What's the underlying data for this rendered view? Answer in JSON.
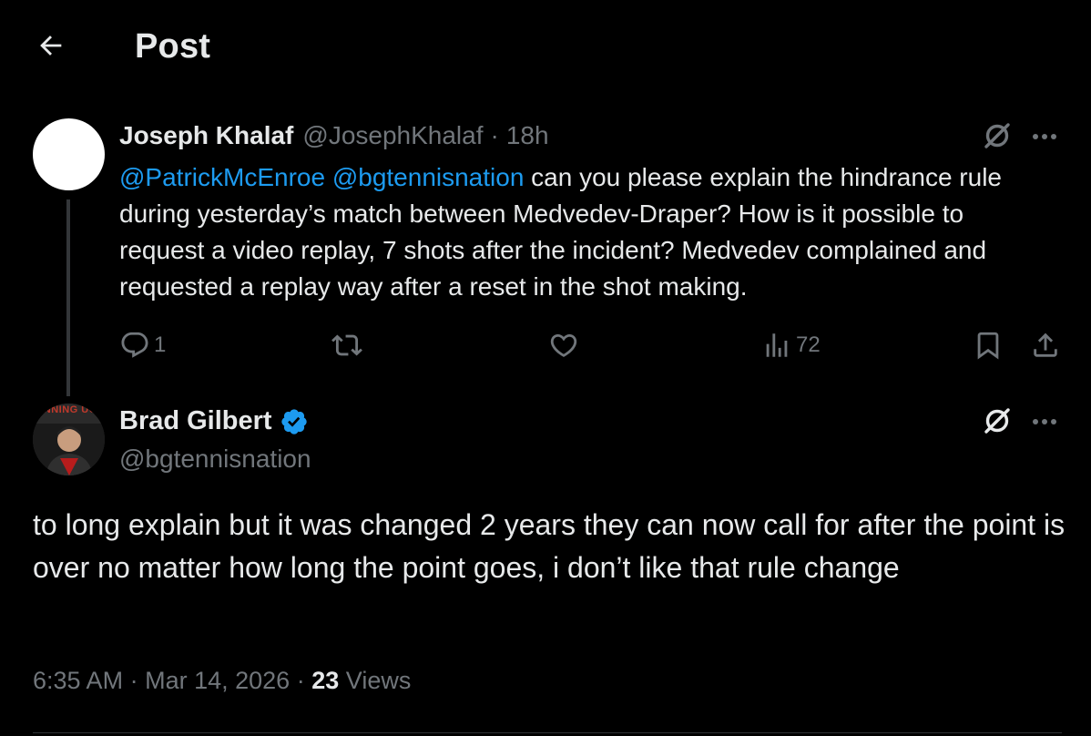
{
  "header": {
    "title": "Post"
  },
  "parent_tweet": {
    "display_name": "Joseph Khalaf",
    "handle": "@JosephKhalaf",
    "separator": "·",
    "time_ago": "18h",
    "mention_1": "@PatrickMcEnroe",
    "mention_2": "@bgtennisnation",
    "text": " can you please explain the hindrance rule during yesterday’s match between Medvedev-Draper? How is it possible to request a video replay, 7 shots after the incident? Medvedev complained and requested a replay way after a reset in the shot making.",
    "reply_count": "1",
    "views_count": "72"
  },
  "reply_tweet": {
    "display_name": "Brad Gilbert",
    "handle": "@bgtennisnation",
    "avatar_banner_text": "INNING UG",
    "text": "to long explain but it was changed 2 years they can now call for after the point is over no matter how long the point goes, i don’t like that rule change",
    "time": "6:35 AM",
    "separator": "·",
    "date": "Mar 14, 2026",
    "separator_2": "·",
    "views_count": "23",
    "views_label": "Views"
  },
  "icons": {
    "back": "arrow-left-icon",
    "grok": "grok-icon",
    "more": "more-icon",
    "reply": "reply-icon",
    "repost": "repost-icon",
    "like": "like-icon",
    "views": "views-icon",
    "bookmark": "bookmark-icon",
    "share": "share-icon",
    "verified": "verified-badge-icon"
  },
  "colors": {
    "background": "#000000",
    "text": "#e7e9ea",
    "muted": "#71767b",
    "accent": "#1d9bf0"
  }
}
